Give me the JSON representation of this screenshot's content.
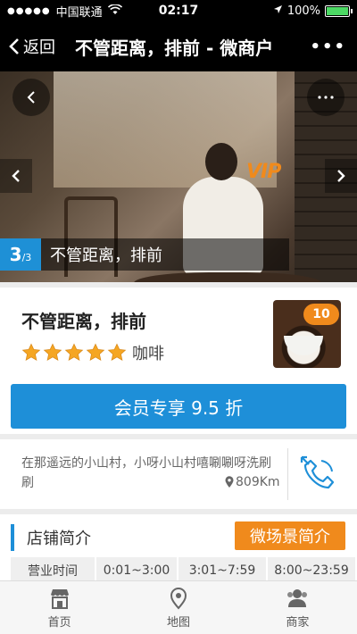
{
  "status_bar": {
    "signal": "●●●●●",
    "carrier": "中国联通",
    "time": "02:17",
    "battery_percent": "100%",
    "battery_level": 1.0
  },
  "nav": {
    "back_label": "返回",
    "title": "不管距离，排前 - 微商户",
    "more_label": "•••"
  },
  "hero": {
    "vip_label": "VIP",
    "counter_current": "3",
    "counter_total": "/3",
    "caption": "不管距离，排前"
  },
  "shop": {
    "name": "不管距离，排前",
    "rating": 5,
    "category": "咖啡",
    "badge": "10",
    "member_button": "会员专享 9.5 折"
  },
  "address": {
    "text": "在那遥远的小山村，小呀小山村嘻唰唰呀洗刷刷",
    "distance": "809Km"
  },
  "intro": {
    "heading": "店铺简介",
    "scene_button": "微场景简介",
    "hours": [
      "营业时间",
      "0:01~3:00",
      "3:01~7:59",
      "8:00~23:59"
    ]
  },
  "tabbar": {
    "items": [
      {
        "label": "首页",
        "icon": "store-icon"
      },
      {
        "label": "地图",
        "icon": "map-pin-icon"
      },
      {
        "label": "商家",
        "icon": "users-icon"
      }
    ]
  },
  "colors": {
    "accent_blue": "#1e8fd8",
    "accent_orange": "#f08a1c",
    "star": "#f5a623"
  }
}
